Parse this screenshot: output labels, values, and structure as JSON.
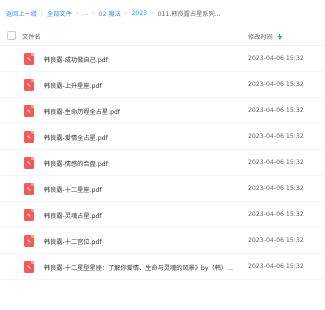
{
  "breadcrumb": {
    "items": [
      {
        "label": "返回上一级"
      },
      {
        "label": "全部文件"
      },
      {
        "label": "..."
      },
      {
        "label": "02 魔法"
      },
      {
        "label": "2023"
      },
      {
        "label": "011.韩良露占星系列..."
      }
    ],
    "separator": "|"
  },
  "header": {
    "name_label": "文件名",
    "date_label": "修改时间"
  },
  "files": [
    {
      "name": "韩良露-成功做自己.pdf",
      "date": "2023-04-06 15:32"
    },
    {
      "name": "韩良露-上升星座.pdf",
      "date": "2023-04-06 15:32"
    },
    {
      "name": "韩良露-生命历程全占星.pdf",
      "date": "2023-04-06 15:32"
    },
    {
      "name": "韩良露-爱情全占星.pdf",
      "date": "2023-04-06 15:32"
    },
    {
      "name": "韩良露-情感的合盘.pdf",
      "date": "2023-04-06 15:32"
    },
    {
      "name": "韩良露-十二星座.pdf",
      "date": "2023-04-06 15:32"
    },
    {
      "name": "韩良露-灵魂占星.pdf",
      "date": "2023-04-06 15:32"
    },
    {
      "name": "韩良露-十二宫位.pdf",
      "date": "2023-04-06 15:32"
    },
    {
      "name": "韩良露-十二星型星座：了解你爱情、生命与灵魂的风景》by（韩）...",
      "date": "2023-04-06 15:32"
    }
  ],
  "colors": {
    "link": "#3b8cff",
    "pdf_icon": "#f25b5b"
  }
}
